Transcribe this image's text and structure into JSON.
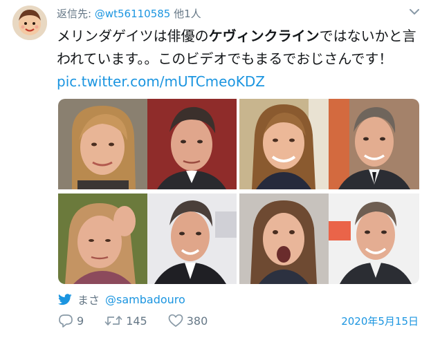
{
  "reply": {
    "prefix": "返信先:",
    "handle": "@wt56110585",
    "suffix": "他1人"
  },
  "tweet": {
    "text_part1": "メリンダゲイツは俳優の",
    "text_bold": "ケヴィンクライン",
    "text_part2": "ではないかと言われています。。このビデオでもまるでおじさんです！ ",
    "link": "pic.twitter.com/mUTCmeoKDZ"
  },
  "photos": [
    {
      "name": "photo-melinda-1"
    },
    {
      "name": "photo-kevin-1"
    },
    {
      "name": "photo-melinda-2"
    },
    {
      "name": "photo-kevin-2"
    },
    {
      "name": "photo-melinda-3"
    },
    {
      "name": "photo-kevin-3"
    },
    {
      "name": "photo-melinda-4"
    },
    {
      "name": "photo-kevin-4"
    }
  ],
  "attribution": {
    "icon": "twitter-bird-icon",
    "name": "まさ",
    "handle": "@sambadouro"
  },
  "actions": {
    "replies": "9",
    "retweets": "145",
    "likes": "380"
  },
  "date": "2020年5月15日",
  "colors": {
    "link": "#1b95e0",
    "muted": "#657786",
    "text": "#14171a"
  }
}
